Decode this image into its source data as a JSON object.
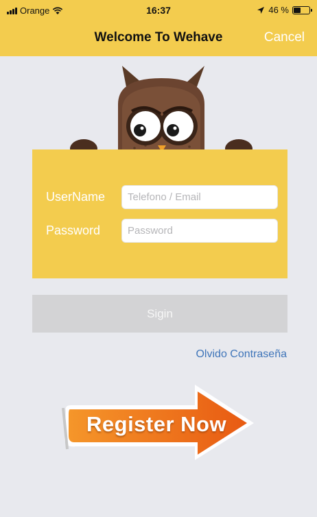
{
  "status_bar": {
    "carrier": "Orange",
    "time": "16:37",
    "battery_percent_text": "46 %",
    "battery_level": 0.46
  },
  "nav": {
    "title": "Welcome To Wehave",
    "cancel_label": "Cancel"
  },
  "login_form": {
    "username_label": "UserName",
    "username_placeholder": "Telefono / Email",
    "username_value": "",
    "password_label": "Password",
    "password_placeholder": "Password",
    "password_value": ""
  },
  "signin_label": "Sigin",
  "forgot_password_link": "Olvido Contraseña",
  "register_label": "Register Now",
  "colors": {
    "header": "#f3cc4e",
    "background": "#e8e9ee",
    "signin_disabled": "#d3d3d5",
    "link": "#3f75b9",
    "register_orange": "#ef7a1a"
  },
  "icons": [
    "signal-bars-icon",
    "wifi-icon",
    "location-arrow-icon",
    "battery-icon",
    "owl-mascot-image",
    "register-arrow-image"
  ]
}
